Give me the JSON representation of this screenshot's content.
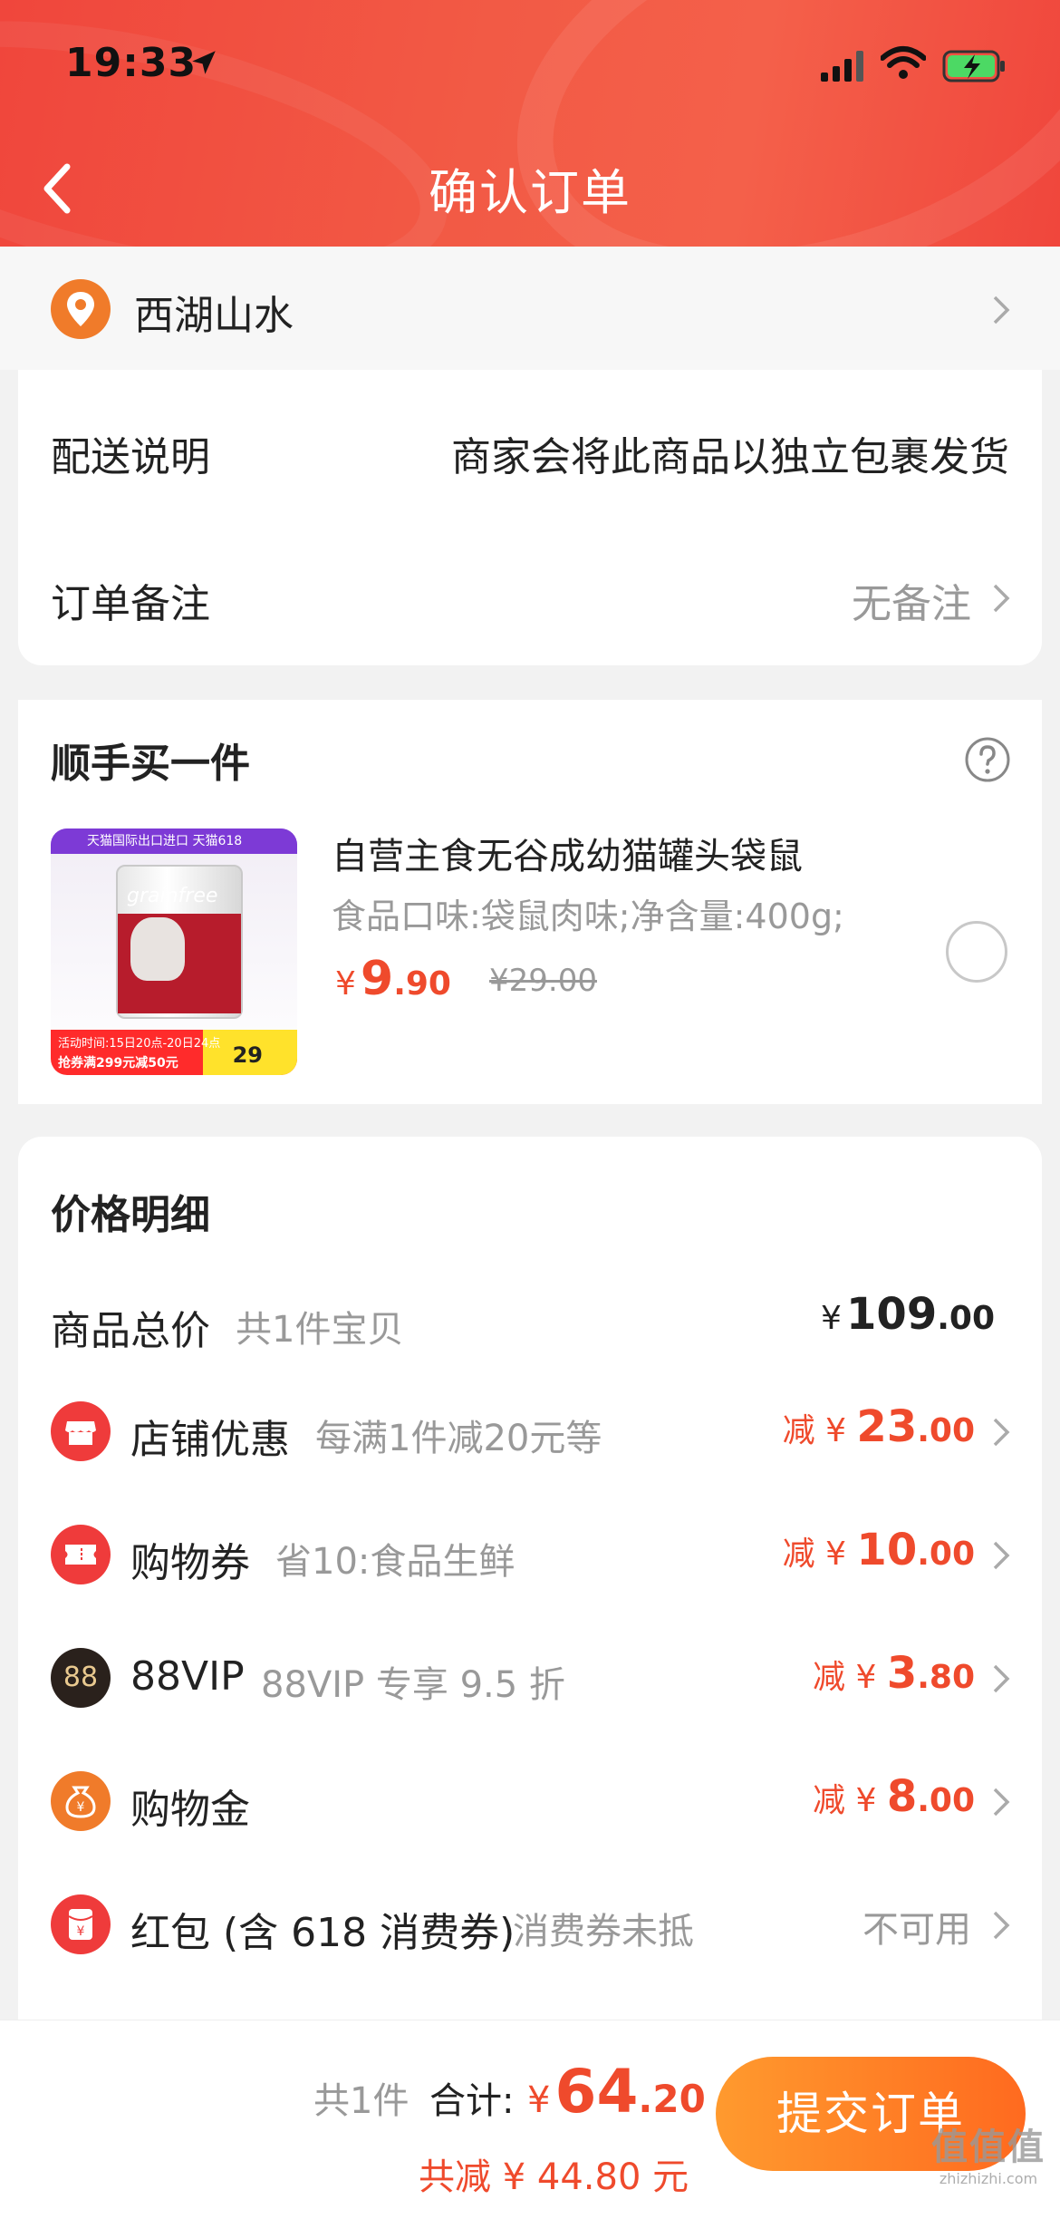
{
  "status_bar": {
    "time": "19:33"
  },
  "nav": {
    "title": "确认订单"
  },
  "address": {
    "label": "西湖山水"
  },
  "delivery": {
    "label": "配送说明",
    "value": "商家会将此商品以独立包裹发货",
    "note_label": "订单备注",
    "note_value": "无备注"
  },
  "upsell": {
    "title": "顺手买一件",
    "product": {
      "name": "自营主食无谷成幼猫罐头袋鼠",
      "spec": "食品口味:袋鼠肉味;净含量:400g;",
      "price_symbol": "¥",
      "price_int": "9",
      "price_dec": ".90",
      "original_price": "¥29.00",
      "image": {
        "banner_text": "天猫国际出口进口 天猫618",
        "brand": "grainfree",
        "promo_time": "活动时间:15日20点-20日24点",
        "promo_coupon": "抢券满299元减50元",
        "promo_price": "29"
      }
    }
  },
  "price_detail": {
    "title": "价格明细",
    "total_row": {
      "label": "商品总价",
      "desc": "共1件宝贝",
      "symbol": "¥",
      "int": "109",
      "dec": ".00"
    },
    "discounts": [
      {
        "icon": "shop-icon",
        "label": "店铺优惠",
        "desc": "每满1件减20元等",
        "prefix": "减 ¥ ",
        "int": "23",
        "dec": ".00"
      },
      {
        "icon": "ticket-icon",
        "label": "购物券",
        "desc": "省10:食品生鲜",
        "prefix": "减 ¥ ",
        "int": "10",
        "dec": ".00"
      },
      {
        "icon": "88vip-icon",
        "icon_text": "88",
        "label": "88VIP",
        "desc": "88VIP 专享 9.5 折",
        "prefix": "减 ¥ ",
        "int": "3",
        "dec": ".80"
      },
      {
        "icon": "money-bag-icon",
        "label": "购物金",
        "desc": "",
        "prefix": "减 ¥ ",
        "int": "8",
        "dec": ".00"
      }
    ],
    "red_packet": {
      "label": "红包 (含 618 消费券)",
      "desc": "消费券未抵",
      "value": "不可用",
      "icon_text": "¥"
    }
  },
  "bottom_bar": {
    "count": "共1件",
    "total_label": "合计:",
    "total_symbol": "¥",
    "total_int": "64",
    "total_dec": ".20",
    "saved": "共减 ¥ 44.80 元",
    "submit_label": "提交订单"
  },
  "watermark": {
    "line1": "值值值",
    "line2": "zhizhizhi.com"
  },
  "colors": {
    "accent": "#ef4a2c",
    "header": "#f0463c",
    "button_start": "#ff9a2e",
    "button_end": "#ff6a1f"
  }
}
